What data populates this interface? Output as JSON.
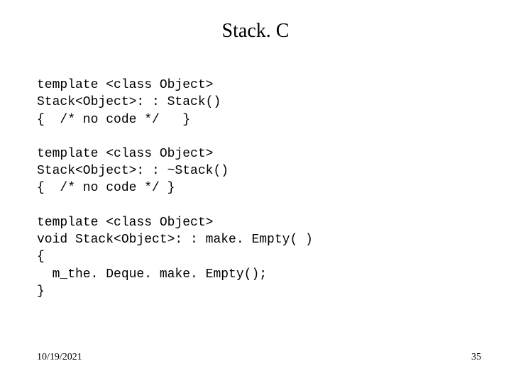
{
  "title": "Stack. C",
  "blocks": [
    "template <class Object>\nStack<Object>: : Stack()\n{  /* no code */   }",
    "template <class Object>\nStack<Object>: : ~Stack()\n{  /* no code */ }",
    "template <class Object>\nvoid Stack<Object>: : make. Empty( )\n{\n  m_the. Deque. make. Empty();\n}"
  ],
  "footer": {
    "date": "10/19/2021",
    "page": "35"
  }
}
